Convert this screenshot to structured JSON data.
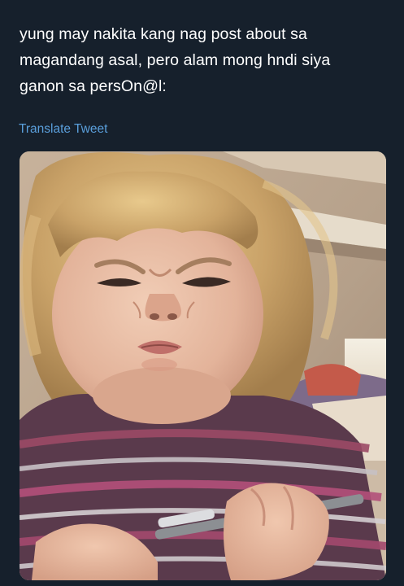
{
  "tweet": {
    "text_lines": [
      "yung may nakita kang nag post about sa",
      "magandang asal, pero alam mong hndi siya",
      "ganon sa persOn@l:"
    ],
    "translate_label": "Translate Tweet"
  },
  "colors": {
    "background": "#16202c",
    "text": "#ffffff",
    "link": "#5a9fdc"
  },
  "media": {
    "icon": "photo-of-grimacing-child"
  }
}
